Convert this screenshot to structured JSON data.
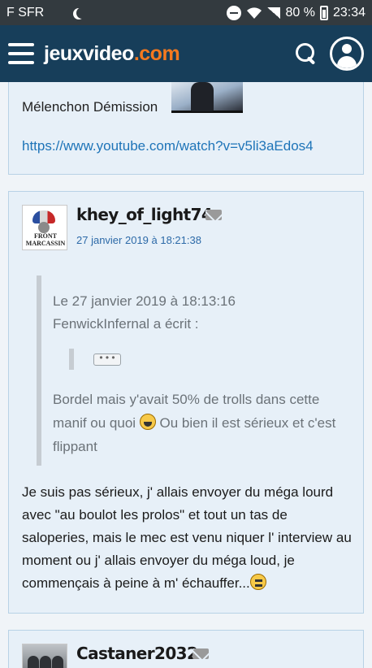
{
  "status_bar": {
    "carrier": "F SFR",
    "battery": "80 %",
    "time": "23:34"
  },
  "header": {
    "logo_main": "jeuxvideo",
    "logo_tld": ".com"
  },
  "posts": [
    {
      "text": "Mélenchon Démission",
      "link": "https://www.youtube.com/watch?v=v5li3aEdos4"
    },
    {
      "username": "khey_of_light74",
      "date": "27 janvier 2019 à 18:21:38",
      "avatar_text": "FRONT MARCASSIN",
      "quote_date": "Le 27 janvier 2019 à 18:13:16",
      "quote_author": "FenwickInfernal a écrit :",
      "quote_collapsed": "• • •",
      "quote_text_a": "Bordel mais y'avait 50% de trolls dans cette manif ou quoi ",
      "quote_text_b": " Ou bien il est sérieux et c'est flippant",
      "message": "Je suis pas sérieux, j' allais envoyer du méga lourd avec \"au boulot les prolos\" et tout un tas de saloperies, mais le mec est venu niquer l' interview au moment ou j' allais envoyer du méga loud, je commençais à peine à m' échauffer..."
    },
    {
      "username": "Castaner2032"
    }
  ]
}
